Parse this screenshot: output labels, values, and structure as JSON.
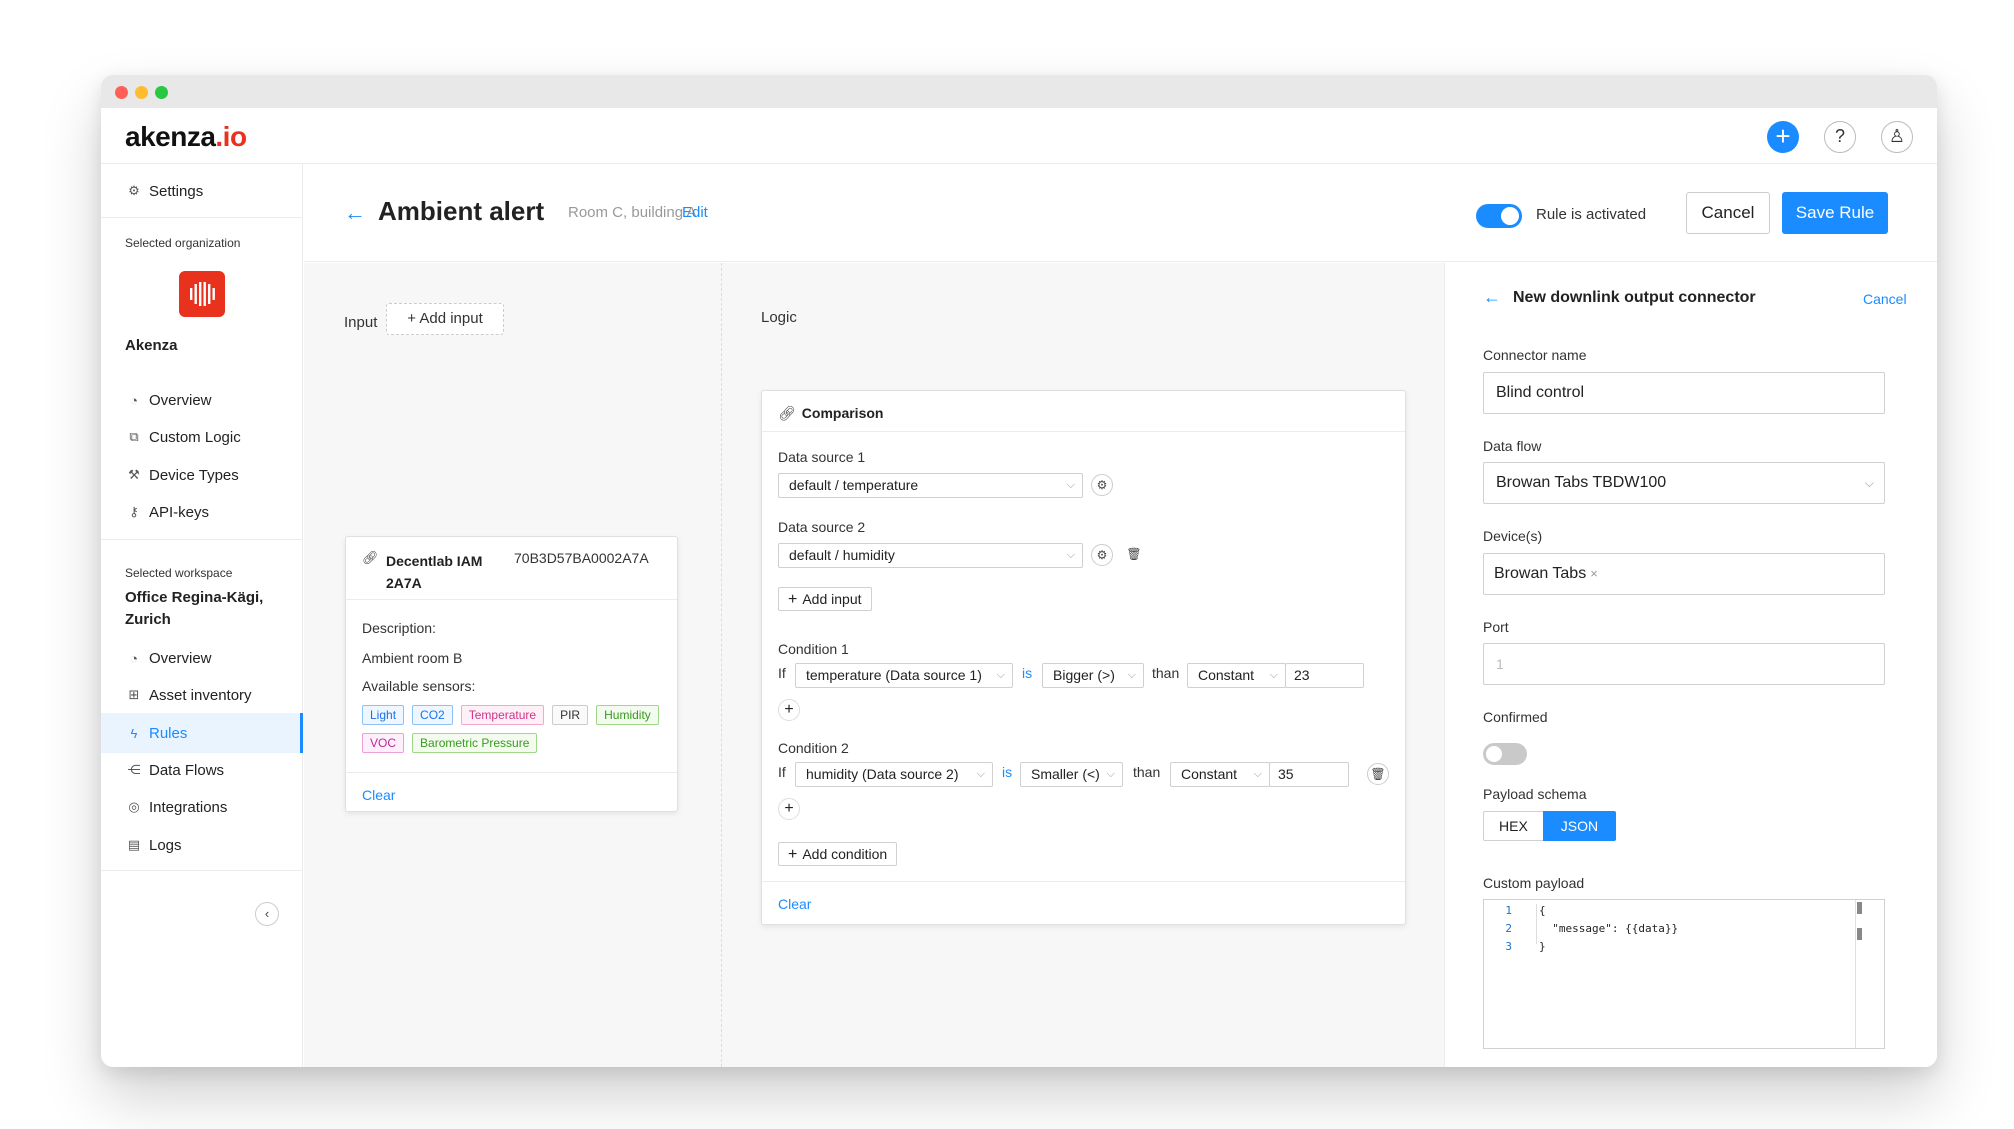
{
  "app": {
    "logo_main": "akenza",
    "logo_suffix": ".io"
  },
  "topbar": {
    "plus_glyph": "+",
    "help_glyph": "?",
    "user_glyph": "♙"
  },
  "sidebar": {
    "settings": "Settings",
    "org_label": "Selected organization",
    "org_name": "Akenza",
    "org_items": [
      "Overview",
      "Custom Logic",
      "Device Types",
      "API-keys"
    ],
    "ws_label": "Selected workspace",
    "ws_name": "Office Regina-Kägi, Zurich",
    "ws_items": [
      "Overview",
      "Asset inventory",
      "Rules",
      "Data Flows",
      "Integrations",
      "Logs"
    ],
    "active_item": "Rules",
    "collapse_glyph": "‹"
  },
  "header": {
    "title": "Ambient alert",
    "subtitle": "Room C, building A",
    "edit": "Edit",
    "toggle_label": "Rule is activated",
    "toggle_on": true,
    "cancel": "Cancel",
    "save": "Save Rule"
  },
  "input_col": {
    "label": "Input",
    "add_input": "Add input"
  },
  "device": {
    "name": "Decentlab IAM 2A7A",
    "id": "70B3D57BA0002A7A",
    "desc_label": "Description:",
    "desc_value": "Ambient room B",
    "sensors_label": "Available sensors:",
    "sensors": [
      "Light",
      "CO2",
      "Temperature",
      "PIR",
      "Humidity",
      "VOC",
      "Barometric Pressure"
    ],
    "clear": "Clear"
  },
  "logic": {
    "label": "Logic",
    "card_title": "Comparison",
    "ds1_label": "Data source 1",
    "ds1_value": "default / temperature",
    "ds2_label": "Data source 2",
    "ds2_value": "default / humidity",
    "add_input": "Add input",
    "cond1_label": "Condition 1",
    "cond1": {
      "if": "If",
      "source": "temperature (Data source 1)",
      "is": "is",
      "op": "Bigger (>)",
      "than": "than",
      "type": "Constant",
      "value": "23"
    },
    "cond2_label": "Condition 2",
    "cond2": {
      "if": "If",
      "source": "humidity (Data source 2)",
      "is": "is",
      "op": "Smaller (<)",
      "than": "than",
      "type": "Constant",
      "value": "35"
    },
    "add_condition": "Add condition",
    "clear": "Clear"
  },
  "panel": {
    "title": "New downlink output connector",
    "cancel": "Cancel",
    "connector_label": "Connector name",
    "connector_value": "Blind control",
    "flow_label": "Data flow",
    "flow_value": "Browan Tabs TBDW100",
    "devices_label": "Device(s)",
    "devices_chip": "Browan Tabs",
    "port_label": "Port",
    "port_placeholder": "1",
    "confirmed_label": "Confirmed",
    "confirmed_on": false,
    "schema_label": "Payload schema",
    "schema_hex": "HEX",
    "schema_json": "JSON",
    "schema_selected": "JSON",
    "payload_label": "Custom payload",
    "payload_lines": [
      "{",
      "  \"message\": {{data}}",
      "}"
    ]
  },
  "colors": {
    "accent": "#1a8cff",
    "brand_red": "#e8321e"
  }
}
